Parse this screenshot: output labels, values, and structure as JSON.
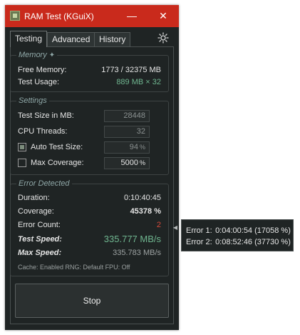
{
  "window": {
    "title": "RAM Test (KGuiX)",
    "minimize_glyph": "—",
    "close_glyph": "✕"
  },
  "tabs": [
    {
      "label": "Testing",
      "active": true
    },
    {
      "label": "Advanced",
      "active": false
    },
    {
      "label": "History",
      "active": false
    }
  ],
  "settings_icon": "gear-icon",
  "memory": {
    "legend": "Memory",
    "legend_icon": "sparkle-icon",
    "free_label": "Free Memory:",
    "free_value": "1773 / 32375 MB",
    "usage_label": "Test Usage:",
    "usage_value": "889 MB × 32"
  },
  "settings": {
    "legend": "Settings",
    "test_size_label": "Test Size in MB:",
    "test_size_value": "28448",
    "threads_label": "CPU Threads:",
    "threads_value": "32",
    "auto_size_label": "Auto Test Size:",
    "auto_size_checked": true,
    "auto_size_value": "94",
    "auto_size_unit": "%",
    "max_cov_label": "Max Coverage:",
    "max_cov_checked": false,
    "max_cov_value": "5000",
    "max_cov_unit": "%"
  },
  "errors": {
    "legend": "Error Detected",
    "duration_label": "Duration:",
    "duration_value": "0:10:40:45",
    "coverage_label": "Coverage:",
    "coverage_value": "45378 %",
    "error_count_label": "Error Count:",
    "error_count_value": "2",
    "test_speed_label": "Test Speed:",
    "test_speed_value": "335.777 MB/s",
    "max_speed_label": "Max Speed:",
    "max_speed_value": "335.783 MB/s",
    "footer": "Cache: Enabled  RNG: Default  FPU: Off"
  },
  "stop_label": "Stop",
  "colors": {
    "titlebar": "#c92a1c",
    "accent_green": "#6fb58f",
    "error_red": "#d84a3a",
    "background": "#1f2424"
  },
  "tooltip": {
    "rows": [
      {
        "key": "Error 1:",
        "value": "0:04:00:54 (17058 %)"
      },
      {
        "key": "Error 2:",
        "value": "0:08:52:46 (37730 %)"
      }
    ]
  }
}
